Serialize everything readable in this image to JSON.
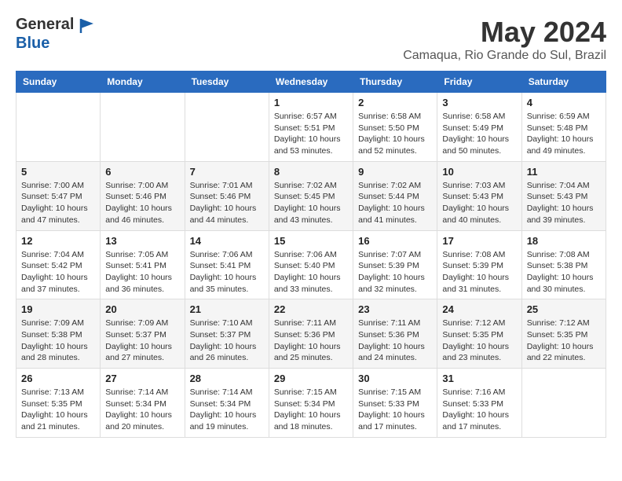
{
  "header": {
    "logo_line1": "General",
    "logo_line2": "Blue",
    "month_title": "May 2024",
    "location": "Camaqua, Rio Grande do Sul, Brazil"
  },
  "days_of_week": [
    "Sunday",
    "Monday",
    "Tuesday",
    "Wednesday",
    "Thursday",
    "Friday",
    "Saturday"
  ],
  "weeks": [
    [
      {
        "day": "",
        "info": ""
      },
      {
        "day": "",
        "info": ""
      },
      {
        "day": "",
        "info": ""
      },
      {
        "day": "1",
        "info": "Sunrise: 6:57 AM\nSunset: 5:51 PM\nDaylight: 10 hours and 53 minutes."
      },
      {
        "day": "2",
        "info": "Sunrise: 6:58 AM\nSunset: 5:50 PM\nDaylight: 10 hours and 52 minutes."
      },
      {
        "day": "3",
        "info": "Sunrise: 6:58 AM\nSunset: 5:49 PM\nDaylight: 10 hours and 50 minutes."
      },
      {
        "day": "4",
        "info": "Sunrise: 6:59 AM\nSunset: 5:48 PM\nDaylight: 10 hours and 49 minutes."
      }
    ],
    [
      {
        "day": "5",
        "info": "Sunrise: 7:00 AM\nSunset: 5:47 PM\nDaylight: 10 hours and 47 minutes."
      },
      {
        "day": "6",
        "info": "Sunrise: 7:00 AM\nSunset: 5:46 PM\nDaylight: 10 hours and 46 minutes."
      },
      {
        "day": "7",
        "info": "Sunrise: 7:01 AM\nSunset: 5:46 PM\nDaylight: 10 hours and 44 minutes."
      },
      {
        "day": "8",
        "info": "Sunrise: 7:02 AM\nSunset: 5:45 PM\nDaylight: 10 hours and 43 minutes."
      },
      {
        "day": "9",
        "info": "Sunrise: 7:02 AM\nSunset: 5:44 PM\nDaylight: 10 hours and 41 minutes."
      },
      {
        "day": "10",
        "info": "Sunrise: 7:03 AM\nSunset: 5:43 PM\nDaylight: 10 hours and 40 minutes."
      },
      {
        "day": "11",
        "info": "Sunrise: 7:04 AM\nSunset: 5:43 PM\nDaylight: 10 hours and 39 minutes."
      }
    ],
    [
      {
        "day": "12",
        "info": "Sunrise: 7:04 AM\nSunset: 5:42 PM\nDaylight: 10 hours and 37 minutes."
      },
      {
        "day": "13",
        "info": "Sunrise: 7:05 AM\nSunset: 5:41 PM\nDaylight: 10 hours and 36 minutes."
      },
      {
        "day": "14",
        "info": "Sunrise: 7:06 AM\nSunset: 5:41 PM\nDaylight: 10 hours and 35 minutes."
      },
      {
        "day": "15",
        "info": "Sunrise: 7:06 AM\nSunset: 5:40 PM\nDaylight: 10 hours and 33 minutes."
      },
      {
        "day": "16",
        "info": "Sunrise: 7:07 AM\nSunset: 5:39 PM\nDaylight: 10 hours and 32 minutes."
      },
      {
        "day": "17",
        "info": "Sunrise: 7:08 AM\nSunset: 5:39 PM\nDaylight: 10 hours and 31 minutes."
      },
      {
        "day": "18",
        "info": "Sunrise: 7:08 AM\nSunset: 5:38 PM\nDaylight: 10 hours and 30 minutes."
      }
    ],
    [
      {
        "day": "19",
        "info": "Sunrise: 7:09 AM\nSunset: 5:38 PM\nDaylight: 10 hours and 28 minutes."
      },
      {
        "day": "20",
        "info": "Sunrise: 7:09 AM\nSunset: 5:37 PM\nDaylight: 10 hours and 27 minutes."
      },
      {
        "day": "21",
        "info": "Sunrise: 7:10 AM\nSunset: 5:37 PM\nDaylight: 10 hours and 26 minutes."
      },
      {
        "day": "22",
        "info": "Sunrise: 7:11 AM\nSunset: 5:36 PM\nDaylight: 10 hours and 25 minutes."
      },
      {
        "day": "23",
        "info": "Sunrise: 7:11 AM\nSunset: 5:36 PM\nDaylight: 10 hours and 24 minutes."
      },
      {
        "day": "24",
        "info": "Sunrise: 7:12 AM\nSunset: 5:35 PM\nDaylight: 10 hours and 23 minutes."
      },
      {
        "day": "25",
        "info": "Sunrise: 7:12 AM\nSunset: 5:35 PM\nDaylight: 10 hours and 22 minutes."
      }
    ],
    [
      {
        "day": "26",
        "info": "Sunrise: 7:13 AM\nSunset: 5:35 PM\nDaylight: 10 hours and 21 minutes."
      },
      {
        "day": "27",
        "info": "Sunrise: 7:14 AM\nSunset: 5:34 PM\nDaylight: 10 hours and 20 minutes."
      },
      {
        "day": "28",
        "info": "Sunrise: 7:14 AM\nSunset: 5:34 PM\nDaylight: 10 hours and 19 minutes."
      },
      {
        "day": "29",
        "info": "Sunrise: 7:15 AM\nSunset: 5:34 PM\nDaylight: 10 hours and 18 minutes."
      },
      {
        "day": "30",
        "info": "Sunrise: 7:15 AM\nSunset: 5:33 PM\nDaylight: 10 hours and 17 minutes."
      },
      {
        "day": "31",
        "info": "Sunrise: 7:16 AM\nSunset: 5:33 PM\nDaylight: 10 hours and 17 minutes."
      },
      {
        "day": "",
        "info": ""
      }
    ]
  ]
}
